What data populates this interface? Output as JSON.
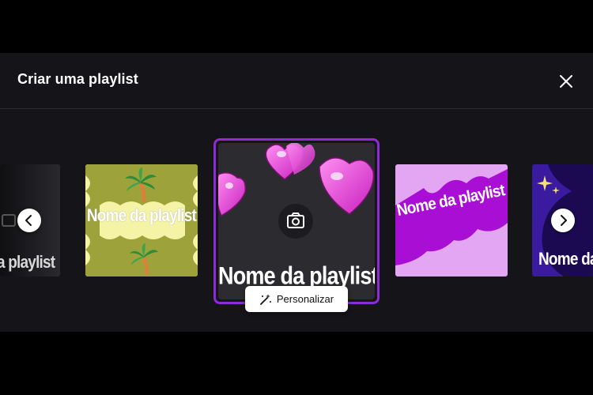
{
  "modal": {
    "title": "Criar uma playlist",
    "close_icon": "close-icon"
  },
  "carousel": {
    "cards": [
      {
        "label": "a playlist",
        "style": "dark-gradient"
      },
      {
        "label": "Nome da playlist",
        "style": "yellow-palm-trees"
      },
      {
        "label": "Nome da playlist",
        "style": "pink-hearts",
        "selected": true
      },
      {
        "label": "Nome da playlist",
        "style": "purple-pink-waves"
      },
      {
        "label": "Nome da",
        "style": "blue-sparkle"
      }
    ],
    "personalize_label": "Personalizar",
    "icons": {
      "prev": "chevron-left-icon",
      "next": "chevron-right-icon",
      "camera": "camera-icon",
      "personalize": "magic-wand-icon"
    }
  },
  "colors": {
    "background": "#000000",
    "modal": "#151418",
    "selection_border": "#8f2bd6"
  }
}
